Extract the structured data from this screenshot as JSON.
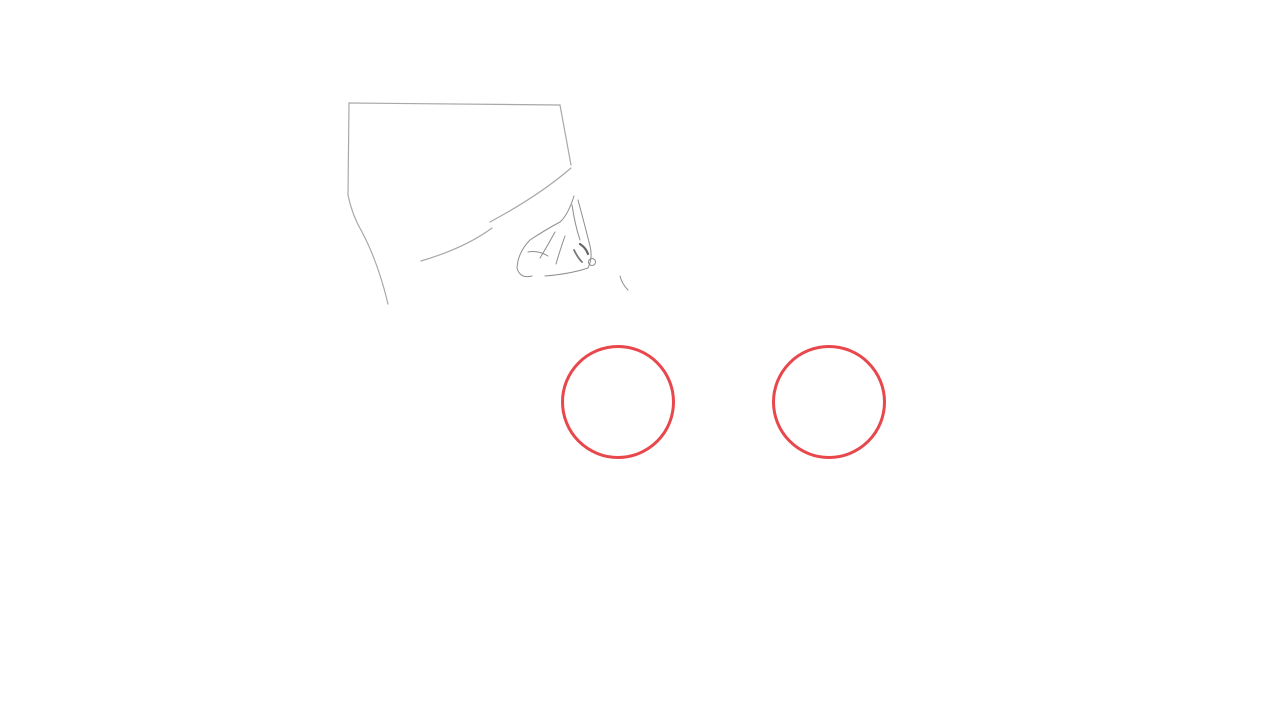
{
  "scene": {
    "background_color": "#ffffff",
    "sketch_stroke_color": "#a8a8a8",
    "sketch_shade_color": "#8e8e8e"
  },
  "hotspots": [
    {
      "id": "left",
      "ring_color": "#e8474c",
      "icon": "circle-outline"
    },
    {
      "id": "right",
      "ring_color": "#e8474c",
      "icon": "circle-outline"
    }
  ]
}
